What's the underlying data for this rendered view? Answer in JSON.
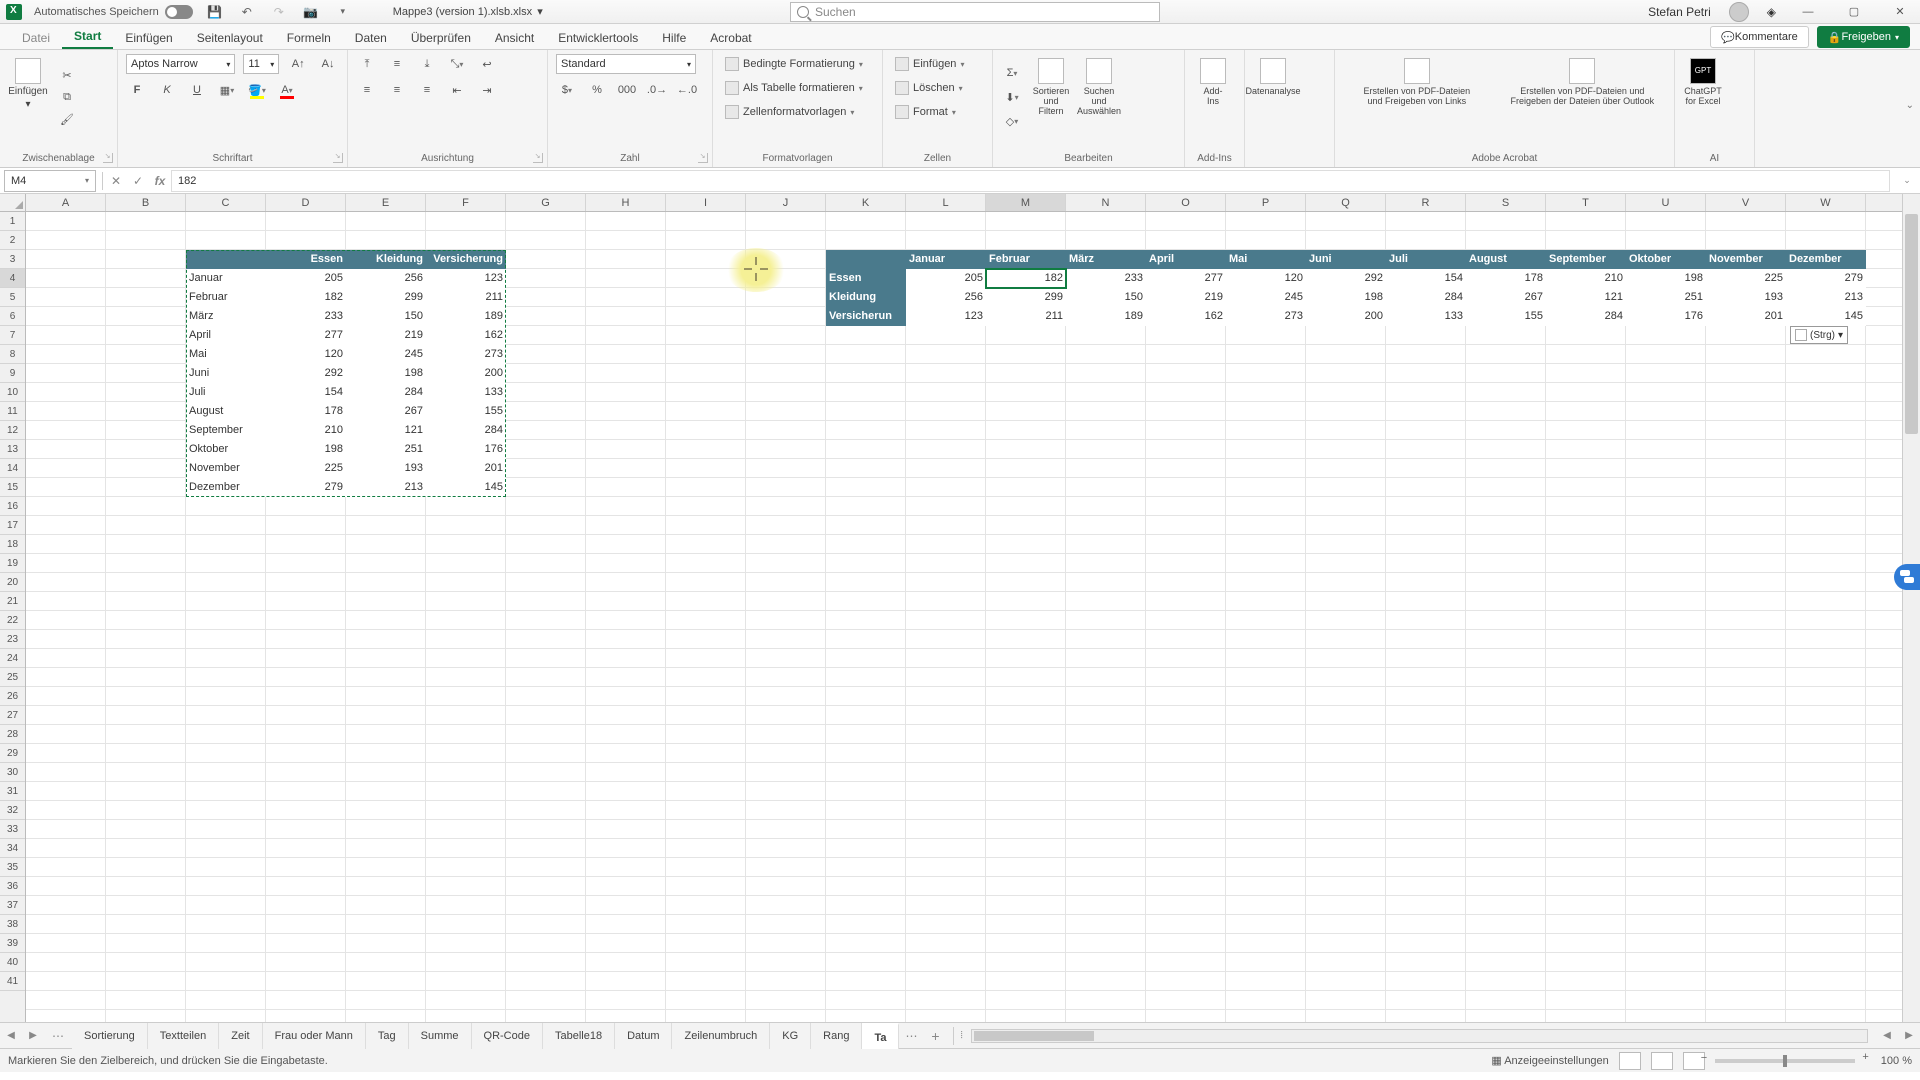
{
  "title": {
    "autosave": "Automatisches Speichern",
    "filename": "Mappe3 (version 1).xlsb.xlsx"
  },
  "search": {
    "placeholder": "Suchen"
  },
  "user": {
    "name": "Stefan Petri"
  },
  "menutabs": {
    "file": "Datei",
    "items": [
      "Start",
      "Einfügen",
      "Seitenlayout",
      "Formeln",
      "Daten",
      "Überprüfen",
      "Ansicht",
      "Entwicklertools",
      "Hilfe",
      "Acrobat"
    ],
    "active": 0,
    "comments": "Kommentare",
    "share": "Freigeben"
  },
  "ribbon": {
    "paste": "Einfügen",
    "clipboard": "Zwischenablage",
    "font": {
      "name": "Aptos Narrow",
      "size": "11",
      "group": "Schriftart",
      "bold": "F",
      "italic": "K",
      "underline": "U"
    },
    "align": "Ausrichtung",
    "number": {
      "format": "Standard",
      "group": "Zahl"
    },
    "styles": {
      "group": "Formatvorlagen",
      "cond": "Bedingte Formatierung",
      "table": "Als Tabelle formatieren",
      "cell": "Zellenformatvorlagen"
    },
    "cells": {
      "group": "Zellen",
      "insert": "Einfügen",
      "delete": "Löschen",
      "format": "Format"
    },
    "editing": {
      "group": "Bearbeiten",
      "sort": "Sortieren und\nFiltern",
      "find": "Suchen und\nAuswählen"
    },
    "addins": {
      "group": "Add-Ins",
      "label": "Add-\nIns"
    },
    "analysis": "Datenanalyse",
    "acrobat": {
      "group": "Adobe Acrobat",
      "a": "Erstellen von PDF-Dateien\nund Freigeben von Links",
      "b": "Erstellen von PDF-Dateien und\nFreigeben der Dateien über Outlook"
    },
    "ai": {
      "group": "AI",
      "label": "ChatGPT\nfor Excel"
    }
  },
  "namebox": "M4",
  "formula": "182",
  "columns": [
    "A",
    "B",
    "C",
    "D",
    "E",
    "F",
    "G",
    "H",
    "I",
    "J",
    "K",
    "L",
    "M",
    "N",
    "O",
    "P",
    "Q",
    "R",
    "S",
    "T",
    "U",
    "V",
    "W"
  ],
  "rows": 41,
  "table1": {
    "headers": [
      "Essen",
      "Kleidung",
      "Versicherung"
    ],
    "rows": [
      {
        "m": "Januar",
        "v": [
          205,
          256,
          123
        ]
      },
      {
        "m": "Februar",
        "v": [
          182,
          299,
          211
        ]
      },
      {
        "m": "März",
        "v": [
          233,
          150,
          189
        ]
      },
      {
        "m": "April",
        "v": [
          277,
          219,
          162
        ]
      },
      {
        "m": "Mai",
        "v": [
          120,
          245,
          273
        ]
      },
      {
        "m": "Juni",
        "v": [
          292,
          198,
          200
        ]
      },
      {
        "m": "Juli",
        "v": [
          154,
          284,
          133
        ]
      },
      {
        "m": "August",
        "v": [
          178,
          267,
          155
        ]
      },
      {
        "m": "September",
        "v": [
          210,
          121,
          284
        ]
      },
      {
        "m": "Oktober",
        "v": [
          198,
          251,
          176
        ]
      },
      {
        "m": "November",
        "v": [
          225,
          193,
          201
        ]
      },
      {
        "m": "Dezember",
        "v": [
          279,
          213,
          145
        ]
      }
    ]
  },
  "table2": {
    "headers": [
      "Januar",
      "Februar",
      "März",
      "April",
      "Mai",
      "Juni",
      "Juli",
      "August",
      "September",
      "Oktober",
      "November",
      "Dezember"
    ],
    "rows": [
      {
        "c": "Essen",
        "v": [
          205,
          182,
          233,
          277,
          120,
          292,
          154,
          178,
          210,
          198,
          225,
          279
        ]
      },
      {
        "c": "Kleidung",
        "v": [
          256,
          299,
          150,
          219,
          245,
          198,
          284,
          267,
          121,
          251,
          193,
          213
        ]
      },
      {
        "c": "Versicherun",
        "v": [
          123,
          211,
          189,
          162,
          273,
          200,
          133,
          155,
          284,
          176,
          201,
          145
        ]
      }
    ]
  },
  "pastetag": "(Strg)",
  "sheets": {
    "list": [
      "Sortierung",
      "Textteilen",
      "Zeit",
      "Frau oder Mann",
      "Tag",
      "Summe",
      "QR-Code",
      "Tabelle18",
      "Datum",
      "Zeilenumbruch",
      "KG",
      "Rang",
      "Ta"
    ],
    "active": 12
  },
  "status": {
    "msg": "Markieren Sie den Zielbereich, und drücken Sie die Eingabetaste.",
    "display": "Anzeigeeinstellungen",
    "zoom": "100 %"
  }
}
